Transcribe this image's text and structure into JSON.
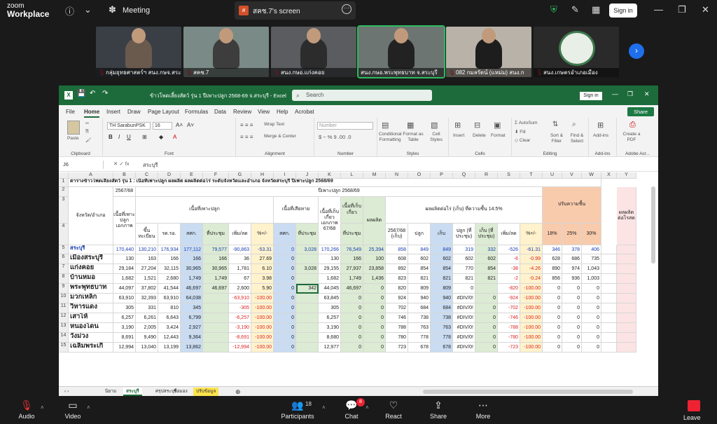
{
  "topbar": {
    "brand_top": "zoom",
    "brand_bottom": "Workplace",
    "meeting": "Meeting",
    "share_badge": "ส",
    "share_title": "สคช.7's screen",
    "sign_in": "Sign in"
  },
  "participants": [
    {
      "name": "กลุ่มยุทธศาสตร์ฯ สนง.กษจ.สระบุรี"
    },
    {
      "name": "สคช.7"
    },
    {
      "name": "สนง.กษอ.แก่งคอย"
    },
    {
      "name": "สนง.กษอ.พระพุทธบาท จ.สระบุรี"
    },
    {
      "name": "082 กมลรัตน์ (แหม่ม) สนง.ก"
    },
    {
      "name": "สนง.เกษตรอำเภอเมือง"
    }
  ],
  "excel": {
    "title": "ข้าวโพดเลี้ยงสัตว์ รุ่น 1 ปีเพาะปลูก 2568-69 จ.สระบุรี  -  Excel",
    "search_placeholder": "Search",
    "sign_in": "Sign in",
    "menu": [
      "File",
      "Home",
      "Insert",
      "Draw",
      "Page Layout",
      "Formulas",
      "Data",
      "Review",
      "View",
      "Help",
      "Acrobat"
    ],
    "share": "Share",
    "ribbon": {
      "paste": "Paste",
      "clipboard": "Clipboard",
      "font_name": "TH SarabunPSK",
      "font_size": "16",
      "font": "Font",
      "wrap_text": "Wrap Text",
      "merge_center": "Merge & Center",
      "alignment": "Alignment",
      "number_format": "Number",
      "number": "Number",
      "conditional": "Conditional Formatting",
      "format_table": "Format as Table",
      "cell_styles": "Cell Styles",
      "styles": "Styles",
      "insert": "Insert",
      "delete": "Delete",
      "format": "Format",
      "cells": "Cells",
      "autosum": "AutoSum",
      "fill": "Fill",
      "clear": "Clear",
      "sort_filter": "Sort & Filter",
      "find_select": "Find & Select",
      "editing": "Editing",
      "addins": "Add-ins",
      "addins_group": "Add-ins",
      "create_pdf": "Create a PDF",
      "adobe": "Adobe Acr..."
    },
    "name_box": "J6",
    "formula": "สระบุรี"
  },
  "sheet": {
    "columns": [
      "A",
      "B",
      "C",
      "D",
      "E",
      "F",
      "G",
      "H",
      "I",
      "J",
      "K",
      "L",
      "M",
      "N",
      "O",
      "P",
      "Q",
      "R",
      "S",
      "T",
      "U",
      "V",
      "W",
      "X",
      "Y"
    ],
    "title": "ตารางข้าวโพดเลี้ยงสัตว์ รุ่น 1 : เนื้อที่เพาะปลูก ผลผลิต ผลผลิตต่อไร่ ระดับจังหวัดและอำเภอ จังหวัดสระบุรี ปีเพาะปลูก 2568/69",
    "h_year_prev": "2567/68",
    "h_year_cur": "ปีเพาะปลูก 2568/69",
    "h_district": "จังหวัด/อำเภอ",
    "h_planted_doc": "เนื้อที่เพาะปลูกเอกภาพ",
    "h_planted_area": "เนื้อที่เพาะปลูก",
    "h_registered": "ขึ้นทะเบียน",
    "h_rdo": "รด.รอ.",
    "h_skt": "สศก.",
    "h_meeting": "ที่ประชุม",
    "h_change": "เพิ่ม/ลด",
    "h_pct": "%+/-",
    "h_damaged": "เนื้อที่เสียหาย",
    "h_dmg_skt": "สศก.",
    "h_dmg_meet": "ที่ประชุม",
    "h_harvest_doc": "เนื้อที่เก็บเกี่ยวเอกภาพ 67/68",
    "h_harvest": "เนื้อที่เก็บเกี่ยว",
    "h_harvest_meet": "ที่ประชุม",
    "h_output": "ผลผลิต",
    "h_output_meet": "ที่ประชุม",
    "h_yield": "ผลผลิตต่อไร่ (เก็บ) ที่ความชื้น 14.5%",
    "h_yield_prev": "2567/68 (เก็บ)",
    "h_plant": "ปลูก",
    "h_harv": "เก็บ",
    "h_plant_meet": "ปลูก (ที่ประชุม)",
    "h_harv_meet": "เก็บ (ที่ประชุม)",
    "h_yield_change": "เพิ่ม/ลด",
    "h_yield_pct": "%+/-",
    "h_moisture": "ปรับความชื้น",
    "h_m18": "18%",
    "h_m25": "25%",
    "h_m30": "30%",
    "h_yield_rai": "ผลผลิตต่อไรสด",
    "rows": [
      {
        "n": "5",
        "a": "สระบุรี",
        "b": "170,440",
        "c": "130,210",
        "d": "176,934",
        "e": "177,112",
        "f": "79,577",
        "g": "-90,863",
        "h": "-53.31",
        "i": "0",
        "j": "3,028",
        "k": "170,266",
        "l": "76,549",
        "m": "25,394",
        "n2": "858",
        "o": "849",
        "p": "849",
        "q": "319",
        "r": "332",
        "s": "-526",
        "t": "-61.31",
        "u": "346",
        "v": "378",
        "w": "406"
      },
      {
        "n": "6",
        "a": "เมืองสระบุรี",
        "b": "130",
        "c": "163",
        "d": "166",
        "e": "166",
        "f": "166",
        "g": "36",
        "h": "27.69",
        "i": "0",
        "j": "",
        "k": "130",
        "l": "166",
        "m": "100",
        "n2": "608",
        "o": "602",
        "p": "602",
        "q": "602",
        "r": "602",
        "s": "-6",
        "t": "-0.99",
        "u": "628",
        "v": "686",
        "w": "735"
      },
      {
        "n": "7",
        "a": "แก่งคอย",
        "b": "29,184",
        "c": "27,204",
        "d": "32,115",
        "e": "30,965",
        "f": "30,965",
        "g": "1,781",
        "h": "6.10",
        "i": "0",
        "j": "3,028",
        "k": "29,155",
        "l": "27,937",
        "m": "23,858",
        "n2": "892",
        "o": "854",
        "p": "854",
        "q": "770",
        "r": "854",
        "s": "-38",
        "t": "-4.26",
        "u": "890",
        "v": "974",
        "w": "1,043"
      },
      {
        "n": "8",
        "a": "บ้านหมอ",
        "b": "1,682",
        "c": "1,521",
        "d": "2,680",
        "e": "1,749",
        "f": "1,749",
        "g": "67",
        "h": "3.98",
        "i": "0",
        "j": "",
        "k": "1,682",
        "l": "1,749",
        "m": "1,436",
        "n2": "823",
        "o": "821",
        "p": "821",
        "q": "821",
        "r": "821",
        "s": "-2",
        "t": "-0.24",
        "u": "856",
        "v": "936",
        "w": "1,003"
      },
      {
        "n": "9",
        "a": "พระพุทธบาท",
        "b": "44,097",
        "c": "37,802",
        "d": "41,544",
        "e": "46,697",
        "f": "46,697",
        "g": "2,600",
        "h": "5.90",
        "i": "0",
        "j": "342",
        "k": "44,045",
        "l": "46,697",
        "m": "0",
        "n2": "820",
        "o": "809",
        "p": "809",
        "q": "0",
        "r": "",
        "s": "-820",
        "t": "-100.00",
        "u": "0",
        "v": "0",
        "w": "0"
      },
      {
        "n": "10",
        "a": "มวกเหล็ก",
        "b": "63,910",
        "c": "32,393",
        "d": "63,910",
        "e": "64,038",
        "f": "",
        "g": "-63,910",
        "h": "-100.00",
        "i": "0",
        "j": "",
        "k": "63,845",
        "l": "0",
        "m": "0",
        "n2": "924",
        "o": "940",
        "p": "940",
        "q": "#DIV/0!",
        "r": "0",
        "s": "-924",
        "t": "-100.00",
        "u": "0",
        "v": "0",
        "w": "0"
      },
      {
        "n": "11",
        "a": "วิหารแดง",
        "b": "305",
        "c": "331",
        "d": "810",
        "e": "345",
        "f": "",
        "g": "-305",
        "h": "-100.00",
        "i": "0",
        "j": "",
        "k": "305",
        "l": "0",
        "m": "0",
        "n2": "702",
        "o": "684",
        "p": "684",
        "q": "#DIV/0!",
        "r": "0",
        "s": "-702",
        "t": "-100.00",
        "u": "0",
        "v": "0",
        "w": "0"
      },
      {
        "n": "12",
        "a": "เสาไห้",
        "b": "6,257",
        "c": "6,261",
        "d": "6,643",
        "e": "6,799",
        "f": "",
        "g": "-6,257",
        "h": "-100.00",
        "i": "0",
        "j": "",
        "k": "6,257",
        "l": "0",
        "m": "0",
        "n2": "746",
        "o": "738",
        "p": "738",
        "q": "#DIV/0!",
        "r": "0",
        "s": "-746",
        "t": "-100.00",
        "u": "0",
        "v": "0",
        "w": "0"
      },
      {
        "n": "13",
        "a": "หนองโดน",
        "b": "3,190",
        "c": "2,005",
        "d": "3,424",
        "e": "2,927",
        "f": "",
        "g": "-3,190",
        "h": "-100.00",
        "i": "0",
        "j": "",
        "k": "3,190",
        "l": "0",
        "m": "0",
        "n2": "788",
        "o": "763",
        "p": "763",
        "q": "#DIV/0!",
        "r": "0",
        "s": "-788",
        "t": "-100.00",
        "u": "0",
        "v": "0",
        "w": "0"
      },
      {
        "n": "14",
        "a": "วังม่วง",
        "b": "8,691",
        "c": "9,490",
        "d": "12,443",
        "e": "9,364",
        "f": "",
        "g": "-8,691",
        "h": "-100.00",
        "i": "0",
        "j": "",
        "k": "8,680",
        "l": "0",
        "m": "0",
        "n2": "780",
        "o": "778",
        "p": "778",
        "q": "#DIV/0!",
        "r": "0",
        "s": "-780",
        "t": "-100.00",
        "u": "0",
        "v": "0",
        "w": "0"
      },
      {
        "n": "15",
        "a": "เฉลิมพระเกี",
        "b": "12,994",
        "c": "13,040",
        "d": "13,199",
        "e": "13,862",
        "f": "",
        "g": "-12,994",
        "h": "-100.00",
        "i": "0",
        "j": "",
        "k": "12,977",
        "l": "0",
        "m": "0",
        "n2": "723",
        "o": "678",
        "p": "678",
        "q": "#DIV/0!",
        "r": "0",
        "s": "-723",
        "t": "-100.00",
        "u": "0",
        "v": "0",
        "w": "0"
      }
    ]
  },
  "tabs": [
    "นิยาม",
    "สระบุรี",
    "ศรุปสระบุรี",
    "ข้อมอง",
    "ปรับข้อมูล"
  ],
  "toolbar": {
    "audio": "Audio",
    "video": "Video",
    "participants": "Participants",
    "participants_count": "18",
    "chat": "Chat",
    "chat_badge": "8",
    "react": "React",
    "share": "Share",
    "more": "More",
    "leave": "Leave"
  },
  "colors": {
    "excel_green": "#1d6b3b",
    "blue_fill": "#c9dcf2",
    "green_fill": "#dcebd3",
    "yellow_fill": "#fff2cc",
    "orange_fill": "#f8cbad",
    "pink_fill": "#fce4e4"
  }
}
